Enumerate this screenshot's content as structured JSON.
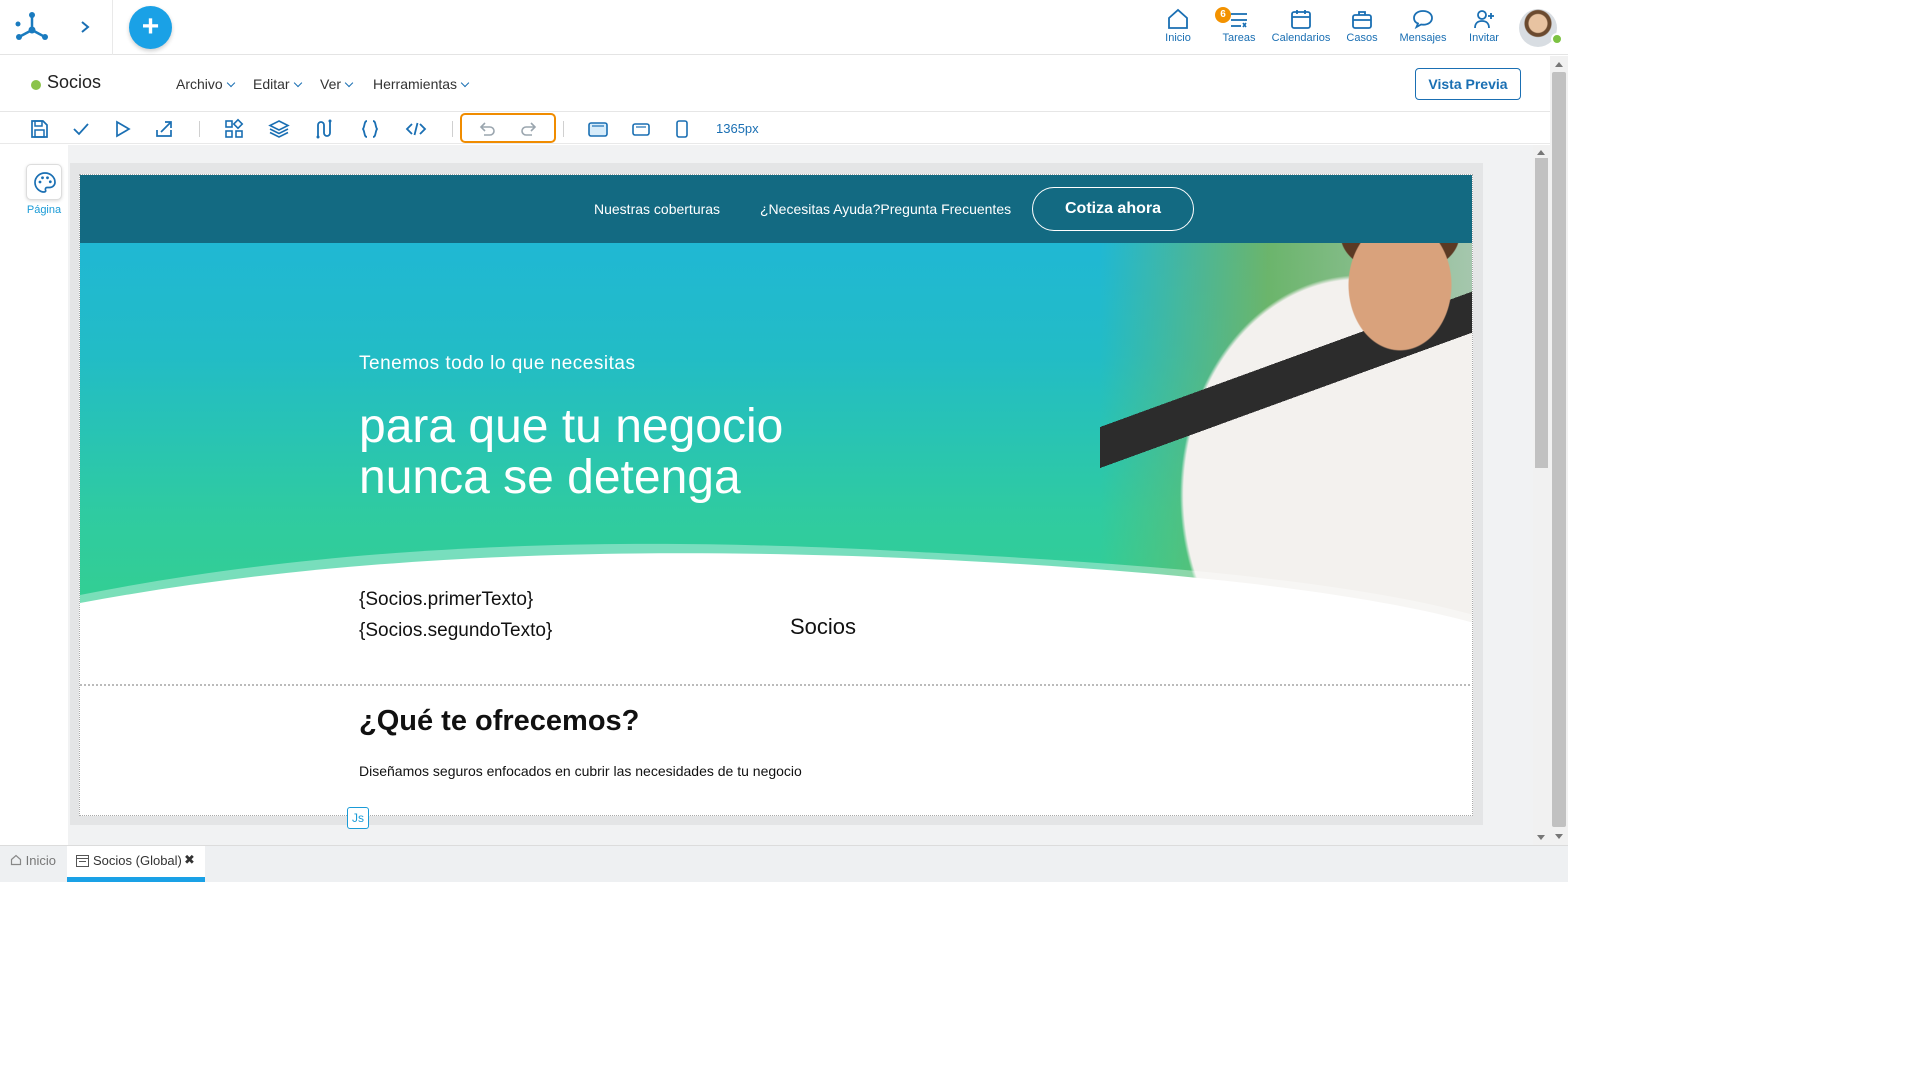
{
  "topbar": {
    "nav": [
      {
        "label": "Inicio",
        "icon": "home-icon"
      },
      {
        "label": "Tareas",
        "icon": "tasks-icon",
        "badge": "6"
      },
      {
        "label": "Calendarios",
        "icon": "calendar-icon"
      },
      {
        "label": "Casos",
        "icon": "briefcase-icon"
      },
      {
        "label": "Mensajes",
        "icon": "chat-icon"
      },
      {
        "label": "Invitar",
        "icon": "invite-user-icon"
      }
    ]
  },
  "doc": {
    "title": "Socios",
    "menus": [
      "Archivo",
      "Editar",
      "Ver",
      "Herramientas"
    ],
    "preview_label": "Vista Previa"
  },
  "toolbar": {
    "width_label": "1365px"
  },
  "sidepanel": {
    "page_label": "Página"
  },
  "canvas": {
    "nav_links": [
      "Nuestras coberturas",
      "¿Necesitas Ayuda?Pregunta Frecuentes"
    ],
    "cta_label": "Cotiza ahora",
    "hero_kicker": "Tenemos todo lo que necesitas",
    "hero_title_line1": "para que tu negocio",
    "hero_title_line2": "nunca se detenga",
    "first_text": "{Socios.primerTexto}",
    "second_text": "{Socios.segundoTexto}",
    "socios_label": "Socios",
    "offer_title": "¿Qué te ofrecemos?",
    "offer_subtitle": "Diseñamos seguros enfocados en cubrir las necesidades de tu negocio",
    "js_tag": "Js"
  },
  "tabs": {
    "home": "Inicio",
    "active": "Socios (Global)",
    "close": "✖"
  },
  "colors": {
    "accent": "#1aa1e6",
    "hero_nav": "#136a82",
    "highlight": "#f08c00",
    "status_green": "#8bc34a"
  }
}
